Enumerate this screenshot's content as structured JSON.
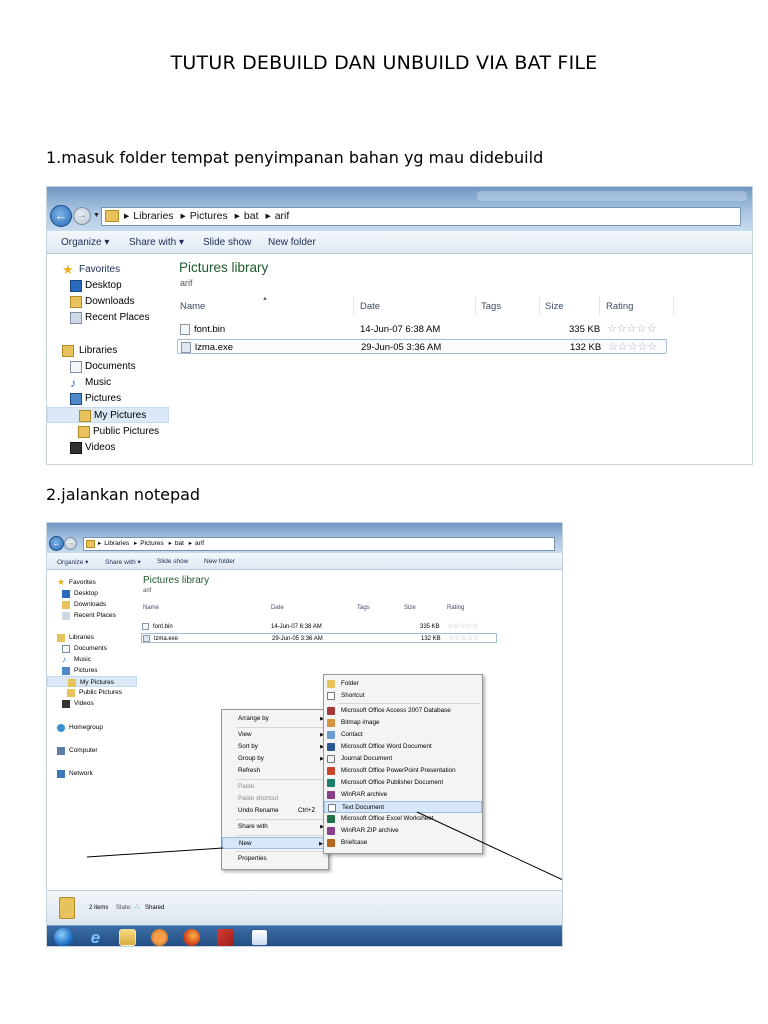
{
  "title": "TUTUR DEBUILD DAN UNBUILD VIA BAT FILE",
  "steps": [
    "1.masuk folder tempat penyimpanan bahan yg mau didebuild",
    "2.jalankan notepad"
  ],
  "explorer": {
    "breadcrumbs": [
      "Libraries",
      "Pictures",
      "bat",
      "arif"
    ],
    "toolbar": {
      "organize": "Organize ▾",
      "share": "Share with ▾",
      "slideshow": "Slide show",
      "newfolder": "New folder"
    },
    "nav": {
      "favorites": "Favorites",
      "desktop": "Desktop",
      "downloads": "Downloads",
      "recent": "Recent Places",
      "libraries": "Libraries",
      "documents": "Documents",
      "music": "Music",
      "pictures": "Pictures",
      "mypictures": "My Pictures",
      "publicpictures": "Public Pictures",
      "videos": "Videos",
      "homegroup": "Homegroup",
      "computer": "Computer",
      "network": "Network"
    },
    "library_title": "Pictures library",
    "library_sub": "arif",
    "columns": {
      "name": "Name",
      "date": "Date",
      "tags": "Tags",
      "size": "Size",
      "rating": "Rating"
    },
    "files": [
      {
        "name": "font.bin",
        "date": "14-Jun-07 6:38 AM",
        "size": "335 KB",
        "rating": "☆☆☆☆☆"
      },
      {
        "name": "lzma.exe",
        "date": "29-Jun-05 3:36 AM",
        "size": "132 KB",
        "rating": "☆☆☆☆☆"
      }
    ]
  },
  "context_menu": {
    "items": [
      "Arrange by",
      "View",
      "Sort by",
      "Group by",
      "Refresh",
      "Paste",
      "Paste shortcut",
      "Undo Rename",
      "Share with",
      "New",
      "Properties"
    ],
    "undo_shortcut": "Ctrl+Z"
  },
  "new_submenu": [
    "Folder",
    "Shortcut",
    "Microsoft Office Access 2007 Database",
    "Bitmap image",
    "Contact",
    "Microsoft Office Word Document",
    "Journal Document",
    "Microsoft Office PowerPoint Presentation",
    "Microsoft Office Publisher Document",
    "WinRAR archive",
    "Text Document",
    "Microsoft Office Excel Worksheet",
    "WinRAR ZIP archive",
    "Briefcase"
  ],
  "status": {
    "items": "2 items",
    "state_label": "State:",
    "state_value": "Shared"
  },
  "taskbar": [
    "start-orb",
    "ie",
    "explorer",
    "media-player",
    "firefox",
    "app",
    "word"
  ]
}
